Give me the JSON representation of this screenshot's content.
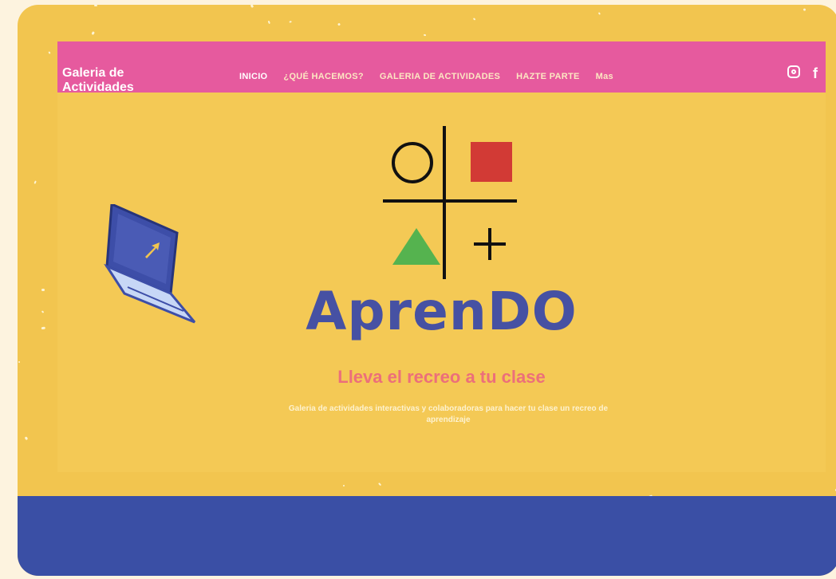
{
  "site": {
    "title": "Galeria de Actividades"
  },
  "nav": {
    "items": [
      {
        "label": "INICIO",
        "active": true
      },
      {
        "label": "¿QUÉ HACEMOS?",
        "active": false
      },
      {
        "label": "GALERIA DE ACTIVIDADES",
        "active": false
      },
      {
        "label": "HAZTE PARTE",
        "active": false
      },
      {
        "label": "Mas",
        "active": false
      }
    ]
  },
  "social": {
    "icons": [
      "instagram-icon",
      "facebook-icon"
    ],
    "facebook_glyph": "f"
  },
  "hero": {
    "logo_symbols": [
      "circle",
      "square",
      "triangle",
      "plus"
    ],
    "brand": "AprenDO",
    "tagline": "Lleva el recreo a tu clase",
    "subtitle": "Galeria de actividades interactivas y colaboradoras para hacer tu clase un recreo de aprendizaje"
  },
  "colors": {
    "background": "#f2c54f",
    "navbar": "#e65a9e",
    "brand": "#4651a3",
    "tagline": "#ec6f7a",
    "square": "#d23a35",
    "triangle": "#55b34f",
    "bottom_band": "#3a4fa5"
  }
}
